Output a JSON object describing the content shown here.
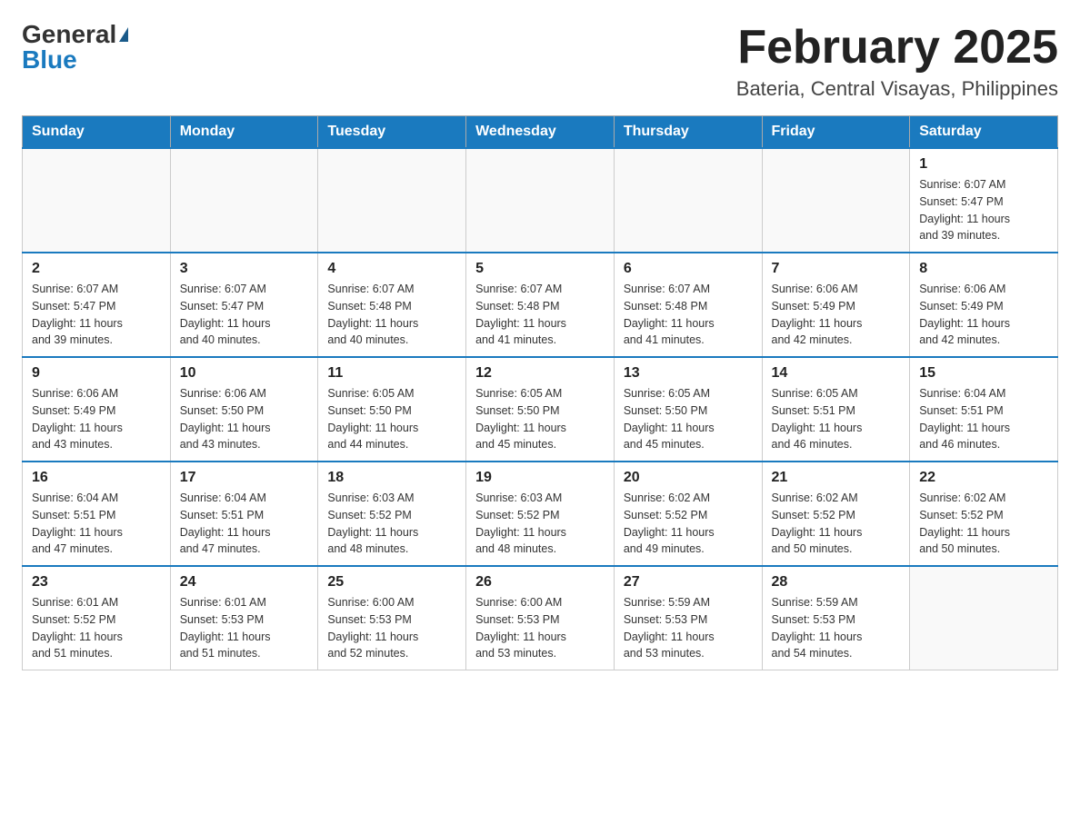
{
  "header": {
    "logo_general": "General",
    "logo_blue": "Blue",
    "month_title": "February 2025",
    "location": "Bateria, Central Visayas, Philippines"
  },
  "weekdays": [
    "Sunday",
    "Monday",
    "Tuesday",
    "Wednesday",
    "Thursday",
    "Friday",
    "Saturday"
  ],
  "weeks": [
    [
      {
        "day": "",
        "info": ""
      },
      {
        "day": "",
        "info": ""
      },
      {
        "day": "",
        "info": ""
      },
      {
        "day": "",
        "info": ""
      },
      {
        "day": "",
        "info": ""
      },
      {
        "day": "",
        "info": ""
      },
      {
        "day": "1",
        "info": "Sunrise: 6:07 AM\nSunset: 5:47 PM\nDaylight: 11 hours\nand 39 minutes."
      }
    ],
    [
      {
        "day": "2",
        "info": "Sunrise: 6:07 AM\nSunset: 5:47 PM\nDaylight: 11 hours\nand 39 minutes."
      },
      {
        "day": "3",
        "info": "Sunrise: 6:07 AM\nSunset: 5:47 PM\nDaylight: 11 hours\nand 40 minutes."
      },
      {
        "day": "4",
        "info": "Sunrise: 6:07 AM\nSunset: 5:48 PM\nDaylight: 11 hours\nand 40 minutes."
      },
      {
        "day": "5",
        "info": "Sunrise: 6:07 AM\nSunset: 5:48 PM\nDaylight: 11 hours\nand 41 minutes."
      },
      {
        "day": "6",
        "info": "Sunrise: 6:07 AM\nSunset: 5:48 PM\nDaylight: 11 hours\nand 41 minutes."
      },
      {
        "day": "7",
        "info": "Sunrise: 6:06 AM\nSunset: 5:49 PM\nDaylight: 11 hours\nand 42 minutes."
      },
      {
        "day": "8",
        "info": "Sunrise: 6:06 AM\nSunset: 5:49 PM\nDaylight: 11 hours\nand 42 minutes."
      }
    ],
    [
      {
        "day": "9",
        "info": "Sunrise: 6:06 AM\nSunset: 5:49 PM\nDaylight: 11 hours\nand 43 minutes."
      },
      {
        "day": "10",
        "info": "Sunrise: 6:06 AM\nSunset: 5:50 PM\nDaylight: 11 hours\nand 43 minutes."
      },
      {
        "day": "11",
        "info": "Sunrise: 6:05 AM\nSunset: 5:50 PM\nDaylight: 11 hours\nand 44 minutes."
      },
      {
        "day": "12",
        "info": "Sunrise: 6:05 AM\nSunset: 5:50 PM\nDaylight: 11 hours\nand 45 minutes."
      },
      {
        "day": "13",
        "info": "Sunrise: 6:05 AM\nSunset: 5:50 PM\nDaylight: 11 hours\nand 45 minutes."
      },
      {
        "day": "14",
        "info": "Sunrise: 6:05 AM\nSunset: 5:51 PM\nDaylight: 11 hours\nand 46 minutes."
      },
      {
        "day": "15",
        "info": "Sunrise: 6:04 AM\nSunset: 5:51 PM\nDaylight: 11 hours\nand 46 minutes."
      }
    ],
    [
      {
        "day": "16",
        "info": "Sunrise: 6:04 AM\nSunset: 5:51 PM\nDaylight: 11 hours\nand 47 minutes."
      },
      {
        "day": "17",
        "info": "Sunrise: 6:04 AM\nSunset: 5:51 PM\nDaylight: 11 hours\nand 47 minutes."
      },
      {
        "day": "18",
        "info": "Sunrise: 6:03 AM\nSunset: 5:52 PM\nDaylight: 11 hours\nand 48 minutes."
      },
      {
        "day": "19",
        "info": "Sunrise: 6:03 AM\nSunset: 5:52 PM\nDaylight: 11 hours\nand 48 minutes."
      },
      {
        "day": "20",
        "info": "Sunrise: 6:02 AM\nSunset: 5:52 PM\nDaylight: 11 hours\nand 49 minutes."
      },
      {
        "day": "21",
        "info": "Sunrise: 6:02 AM\nSunset: 5:52 PM\nDaylight: 11 hours\nand 50 minutes."
      },
      {
        "day": "22",
        "info": "Sunrise: 6:02 AM\nSunset: 5:52 PM\nDaylight: 11 hours\nand 50 minutes."
      }
    ],
    [
      {
        "day": "23",
        "info": "Sunrise: 6:01 AM\nSunset: 5:52 PM\nDaylight: 11 hours\nand 51 minutes."
      },
      {
        "day": "24",
        "info": "Sunrise: 6:01 AM\nSunset: 5:53 PM\nDaylight: 11 hours\nand 51 minutes."
      },
      {
        "day": "25",
        "info": "Sunrise: 6:00 AM\nSunset: 5:53 PM\nDaylight: 11 hours\nand 52 minutes."
      },
      {
        "day": "26",
        "info": "Sunrise: 6:00 AM\nSunset: 5:53 PM\nDaylight: 11 hours\nand 53 minutes."
      },
      {
        "day": "27",
        "info": "Sunrise: 5:59 AM\nSunset: 5:53 PM\nDaylight: 11 hours\nand 53 minutes."
      },
      {
        "day": "28",
        "info": "Sunrise: 5:59 AM\nSunset: 5:53 PM\nDaylight: 11 hours\nand 54 minutes."
      },
      {
        "day": "",
        "info": ""
      }
    ]
  ]
}
